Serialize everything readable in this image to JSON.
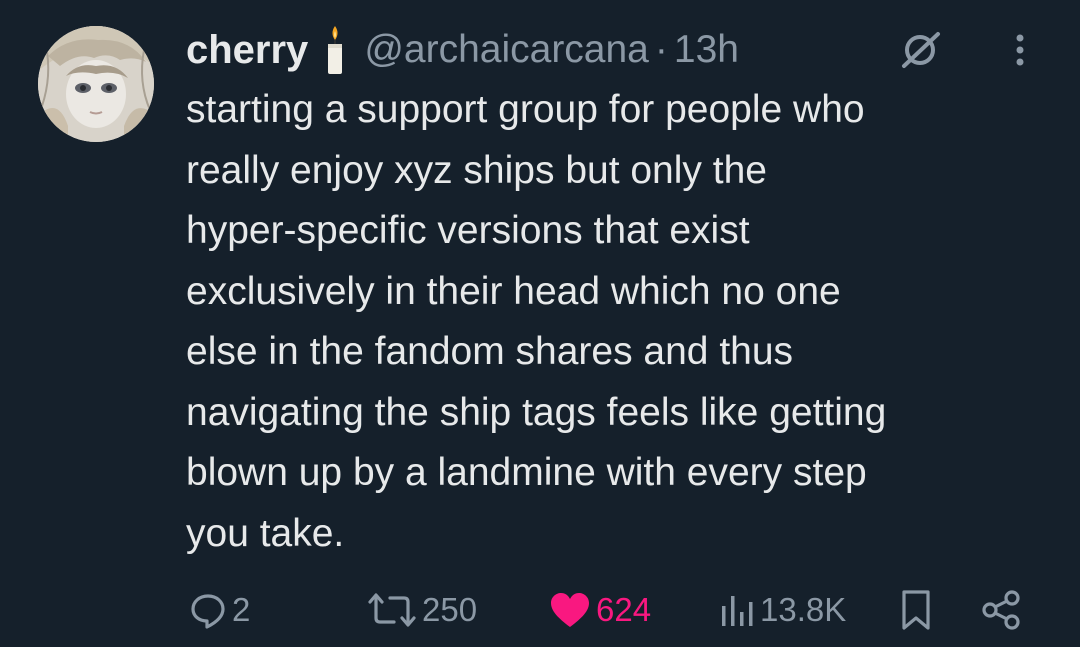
{
  "tweet": {
    "author_name": "cherry",
    "author_emoji": "candle",
    "handle": "@archaicarcana",
    "separator": "·",
    "time": "13h",
    "text_lines": [
      "starting a support group for people who",
      "really enjoy xyz ships but only the",
      "hyper-specific versions that exist",
      "exclusively in their head which no one",
      "else in the fandom shares and thus",
      "navigating the ship tags feels like getting",
      "blown up by a landmine with every step",
      "you take."
    ]
  },
  "actions": {
    "replies": "2",
    "reposts": "250",
    "likes": "624",
    "views": "13.8K"
  },
  "icons": {
    "reply": "reply-icon",
    "repost": "repost-icon",
    "like": "heart-icon",
    "views": "views-icon",
    "bookmark": "bookmark-icon",
    "share": "share-icon",
    "mute": "mute-icon",
    "more": "more-icon"
  },
  "colors": {
    "background": "#15202b",
    "text": "#e7e9ea",
    "secondary": "#8b98a5",
    "like": "#f91880"
  }
}
